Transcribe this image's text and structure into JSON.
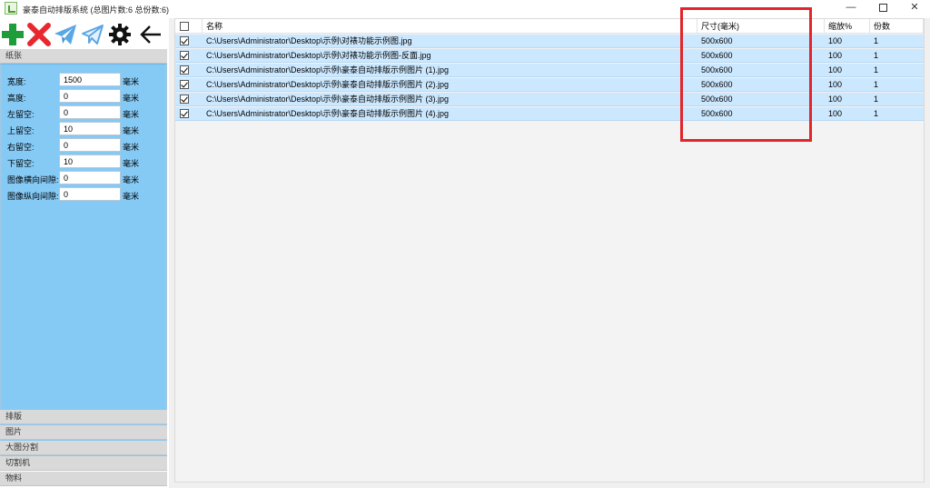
{
  "window": {
    "title": "豪泰自动排版系统 (总图片数:6 总份数:6)",
    "minimize": "—",
    "close": "✕"
  },
  "toolbar": {
    "icons": [
      "plus-icon",
      "delete-x-icon",
      "send-icon",
      "send-outline-icon",
      "gear-icon",
      "back-arrow-icon"
    ]
  },
  "sections": {
    "paper": "纸张",
    "layout": "排版",
    "images": "图片",
    "split": "大图分割",
    "cutter": "切割机",
    "material": "物料"
  },
  "paper_form": [
    {
      "label": "宽度:",
      "value": "1500",
      "unit": "毫米"
    },
    {
      "label": "高度:",
      "value": "0",
      "unit": "毫米"
    },
    {
      "label": "左留空:",
      "value": "0",
      "unit": "毫米"
    },
    {
      "label": "上留空:",
      "value": "10",
      "unit": "毫米"
    },
    {
      "label": "右留空:",
      "value": "0",
      "unit": "毫米"
    },
    {
      "label": "下留空:",
      "value": "10",
      "unit": "毫米"
    },
    {
      "label": "图像横向间隙:",
      "value": "0",
      "unit": "毫米"
    },
    {
      "label": "图像纵向间隙:",
      "value": "0",
      "unit": "毫米"
    }
  ],
  "table": {
    "columns": [
      "名称",
      "尺寸(毫米)",
      "缩放%",
      "份数"
    ],
    "rows": [
      {
        "checked": true,
        "name": "C:\\Users\\Administrator\\Desktop\\示例\\对裱功能示例图.jpg",
        "size": "500x600",
        "scale": "100",
        "copies": "1"
      },
      {
        "checked": true,
        "name": "C:\\Users\\Administrator\\Desktop\\示例\\对裱功能示例图-反面.jpg",
        "size": "500x600",
        "scale": "100",
        "copies": "1"
      },
      {
        "checked": true,
        "name": "C:\\Users\\Administrator\\Desktop\\示例\\豪泰自动排版示例图片 (1).jpg",
        "size": "500x600",
        "scale": "100",
        "copies": "1"
      },
      {
        "checked": true,
        "name": "C:\\Users\\Administrator\\Desktop\\示例\\豪泰自动排版示例图片 (2).jpg",
        "size": "500x600",
        "scale": "100",
        "copies": "1"
      },
      {
        "checked": true,
        "name": "C:\\Users\\Administrator\\Desktop\\示例\\豪泰自动排版示例图片 (3).jpg",
        "size": "500x600",
        "scale": "100",
        "copies": "1"
      },
      {
        "checked": true,
        "name": "C:\\Users\\Administrator\\Desktop\\示例\\豪泰自动排版示例图片 (4).jpg",
        "size": "500x600",
        "scale": "100",
        "copies": "1"
      }
    ]
  },
  "colors": {
    "panel_blue": "#85c9f5",
    "row_selected": "#cce8ff",
    "highlight_red": "#e0262b",
    "plus_green": "#1f9d3a",
    "delete_red": "#e8282e",
    "send_blue": "#5aa7e6"
  }
}
